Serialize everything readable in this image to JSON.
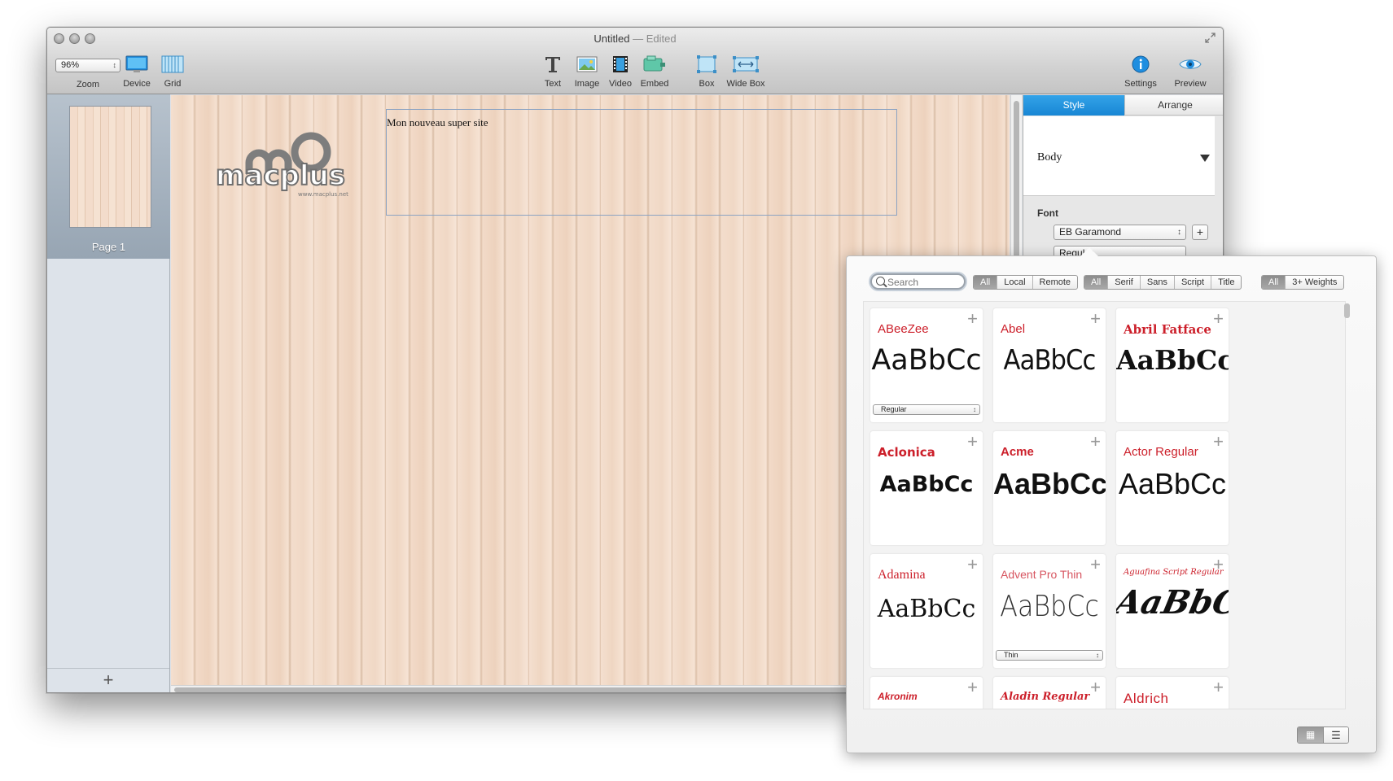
{
  "window": {
    "title": "Untitled",
    "title_sep": " — ",
    "edited": "Edited"
  },
  "toolbar": {
    "zoom_value": "96%",
    "zoom_label": "Zoom",
    "device_label": "Device",
    "grid_label": "Grid",
    "text_label": "Text",
    "image_label": "Image",
    "video_label": "Video",
    "embed_label": "Embed",
    "box_label": "Box",
    "widebox_label": "Wide Box",
    "settings_label": "Settings",
    "preview_label": "Preview"
  },
  "pages": {
    "items": [
      {
        "label": "Page 1"
      }
    ],
    "add_label": "+"
  },
  "canvas": {
    "textbox_text": "Mon nouveau super site",
    "logo_text": "macplus",
    "logo_sub": "www.macplus.net"
  },
  "inspector": {
    "tabs": [
      {
        "label": "Style"
      },
      {
        "label": "Arrange"
      }
    ],
    "style_name": "Body",
    "font_heading": "Font",
    "font_family": "EB Garamond",
    "font_weight": "Regular",
    "add_label": "+"
  },
  "font_picker": {
    "search_placeholder": "Search",
    "source_filters": [
      "All",
      "Local",
      "Remote"
    ],
    "category_filters": [
      "All",
      "Serif",
      "Sans",
      "Script",
      "Title"
    ],
    "weight_filters": [
      "All",
      "3+ Weights"
    ],
    "sample_text": "AaBbCc",
    "fonts": [
      {
        "name": "ABeeZee",
        "weight": "Regular"
      },
      {
        "name": "Abel"
      },
      {
        "name": "Abril Fatface"
      },
      {
        "name": "Aclonica"
      },
      {
        "name": "Acme"
      },
      {
        "name": "Actor Regular"
      },
      {
        "name": "Adamina"
      },
      {
        "name": "Advent Pro Thin",
        "weight": "Thin"
      },
      {
        "name": "Aguafina Script Regular"
      },
      {
        "name": "Akronim"
      },
      {
        "name": "Aladin Regular"
      },
      {
        "name": "Aldrich"
      }
    ],
    "colors": {
      "name": "#cc1f2a",
      "active_tab": "#1886d4"
    }
  }
}
